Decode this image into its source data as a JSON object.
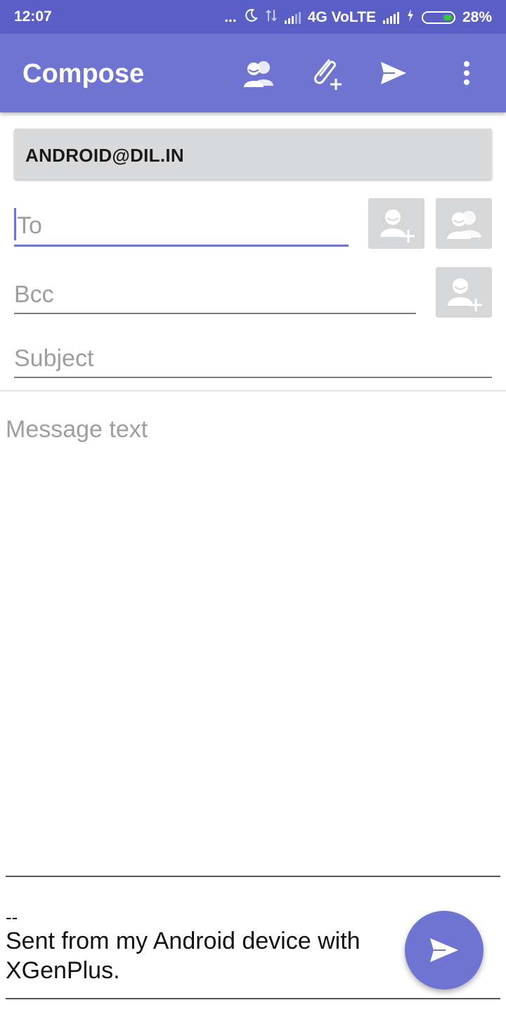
{
  "status_bar": {
    "time": "12:07",
    "dots": "...",
    "network": "4G VoLTE",
    "battery": "28%"
  },
  "app_bar": {
    "title": "Compose",
    "actions": [
      "contacts-icon",
      "attach-icon",
      "send-icon",
      "more-vert-icon"
    ]
  },
  "account": {
    "email": "ANDROID@DIL.IN"
  },
  "fields": {
    "to": {
      "placeholder": "To"
    },
    "bcc": {
      "placeholder": "Bcc"
    },
    "subject": {
      "placeholder": "Subject"
    }
  },
  "body": {
    "placeholder": "Message text",
    "signature_separator": "--",
    "signature_line1": "Sent from my Android device with",
    "signature_line2": "XGenPlus."
  },
  "colors": {
    "accent": "#6f74d2",
    "status_bar": "#5a5fc6"
  }
}
